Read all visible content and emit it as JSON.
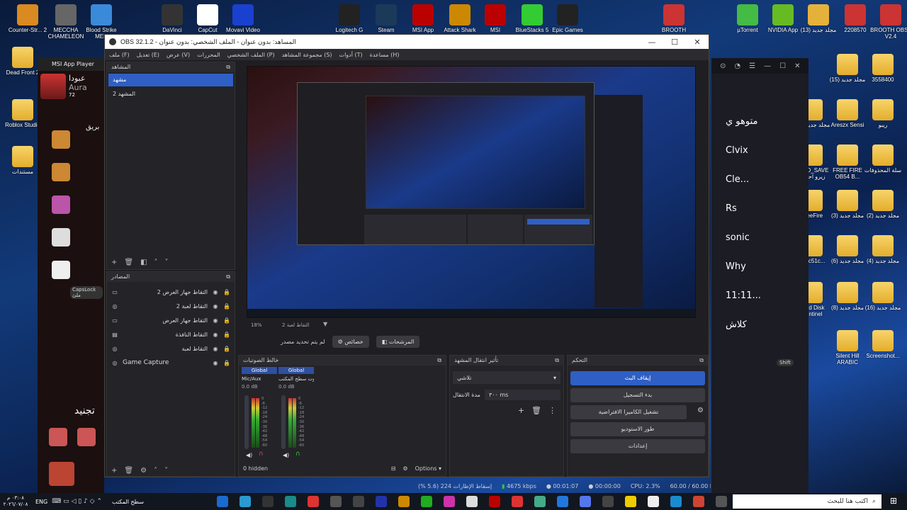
{
  "desktop_icons_top": [
    {
      "label": "Counter-Str... 2",
      "color": "#d98a20"
    },
    {
      "label": "MECCHA CHAMELEON",
      "color": "#666"
    },
    {
      "label": "Blood Strike MEN",
      "color": "#3a8ad9"
    },
    {
      "label": "DaVinci",
      "color": "#333"
    },
    {
      "label": "CapCut",
      "color": "#fff"
    },
    {
      "label": "Movavi Video",
      "color": "#1a40d0"
    },
    {
      "label": "Logitech G",
      "color": "#222"
    },
    {
      "label": "Steam",
      "color": "#1b3a5a"
    },
    {
      "label": "MSI App",
      "color": "#b00"
    },
    {
      "label": "Attack Shark",
      "color": "#c80"
    },
    {
      "label": "MSI",
      "color": "#b00"
    },
    {
      "label": "BlueStacks 5",
      "color": "#3c3"
    },
    {
      "label": "Epic Games",
      "color": "#222"
    },
    {
      "label": "BROOTH",
      "color": "#c33"
    },
    {
      "label": "µTorrent",
      "color": "#4b4"
    },
    {
      "label": "NVIDIA App",
      "color": "#6b2"
    },
    {
      "label": "مجلد جديد (13)",
      "color": "#e4b23a"
    },
    {
      "label": "2208570",
      "color": "#c33"
    },
    {
      "label": "BROOTH OBS4 V2.4",
      "color": "#c33"
    }
  ],
  "desktop_icons_left": [
    {
      "label": "Dead Front 2"
    },
    {
      "label": "Roblox Studio"
    },
    {
      "label": "مستندات"
    }
  ],
  "desktop_icons_right": [
    {
      "label": "مجلد جديد (15)"
    },
    {
      "label": "3558400"
    },
    {
      "label": "مجلد جديد (17)"
    },
    {
      "label": "Areszx Sensi"
    },
    {
      "label": "ريبو"
    },
    {
      "label": "ZEPO_SAVE زيرو احتصد"
    },
    {
      "label": "FREE FIRE OB54 B..."
    },
    {
      "label": "سلة المحذوفات"
    },
    {
      "label": "FreeFire"
    },
    {
      "label": "مجلد جديد (3)"
    },
    {
      "label": "مجلد جديد (2)"
    },
    {
      "label": "9b2c51c..."
    },
    {
      "label": "مجلد جديد (6)"
    },
    {
      "label": "مجلد جديد (4)"
    },
    {
      "label": "Hard Disk Sentinel"
    },
    {
      "label": "مجلد جديد (8)"
    },
    {
      "label": "مجلد جديد (16)"
    },
    {
      "label": "Silent Hill ARABIC"
    },
    {
      "label": "Screenshot..."
    }
  ],
  "msi_player": {
    "title": "MSI App Player",
    "aura_label": "Aura",
    "aura_level": "72",
    "arabic_name": "عبودا",
    "caps_lock": "CapsLock ملئ",
    "recruit": "تجنيد"
  },
  "obs": {
    "window_title": "OBS 32.1.2 - المساهد: بدون عنوان - الملف الشخصي: بدون عنوان",
    "menu": [
      "ملف (F)",
      "تعديل (E)",
      "عرض (V)",
      "المحررات",
      "الملف الشخصي (P)",
      "مجموعة المشاهد (S)",
      "أدوات (T)",
      "مساعدة (H)"
    ],
    "scenes_header": "المشاهد",
    "scenes": [
      "مشهد",
      "المشهد 2"
    ],
    "sources_header": "المصادر",
    "sources": [
      {
        "name": "التقاط جهاز العرض 2",
        "icon": "monitor-icon"
      },
      {
        "name": "التقاط لعبة 2",
        "icon": "gamepad-icon"
      },
      {
        "name": "التقاط جهاز العرض",
        "icon": "monitor-icon"
      },
      {
        "name": "التقاط النافذة",
        "icon": "window-icon"
      },
      {
        "name": "التقاط لعبة",
        "icon": "gamepad-icon"
      },
      {
        "name": "Game Capture",
        "icon": "gamepad-icon"
      }
    ],
    "preview_zoom": "18%",
    "preview_hint": "التقاط لعبة 2",
    "preview_bar": {
      "no_source": "لم يتم تحديد مصدر",
      "properties": "خصائص",
      "filters": "المرشحات"
    },
    "mixer_header": "خالط الصوتيات",
    "mixer": [
      {
        "scope": "Global",
        "name": "Mic/Aux",
        "db": "0.0 dB"
      },
      {
        "scope": "Global",
        "name": "صوت سطح المكتب",
        "db": "0.0 dB"
      }
    ],
    "meter_ticks": [
      "0",
      "-6",
      "-12",
      "-18",
      "-24",
      "-30",
      "-36",
      "-42",
      "-48",
      "-54",
      "-60"
    ],
    "mixer_hidden": "0 hidden",
    "mixer_options": "Options",
    "transitions_header": "تأثير انتقال المشهد",
    "transition_value": "تلاشي",
    "duration_label": "مدة الانتقال",
    "duration_value": "٣٠٠ ms",
    "controls_header": "التحكم",
    "controls": [
      "إيقاف البث",
      "بدء التسجيل",
      "تشغيل الكاميرا الافتراضية",
      "طور الاستوديو",
      "إعدادات"
    ],
    "status": {
      "dropped": "إسقاط الإطارات 224 (5.6 %)",
      "bitrate": "4675 kbps",
      "stream_time": "00:01:07",
      "rec_time": "00:00:00",
      "cpu": "CPU: 2.3%",
      "fps": "60.00 / 60.00 FPS"
    }
  },
  "bluestacks": {
    "labels": [
      "متوهو ي",
      "Clvix",
      "Cle...",
      "Rs",
      "sonic",
      "Why",
      "11:11...",
      "كلاش"
    ],
    "shift": "Shift"
  },
  "taskbar": {
    "search_placeholder": "اكتب هنا للبحث",
    "desktop_label": "سطح المكتب",
    "lang": "ENG",
    "time": "٠٣:٠٨ م",
    "date": "٢٠٢٦/٠٧/٠٨"
  }
}
